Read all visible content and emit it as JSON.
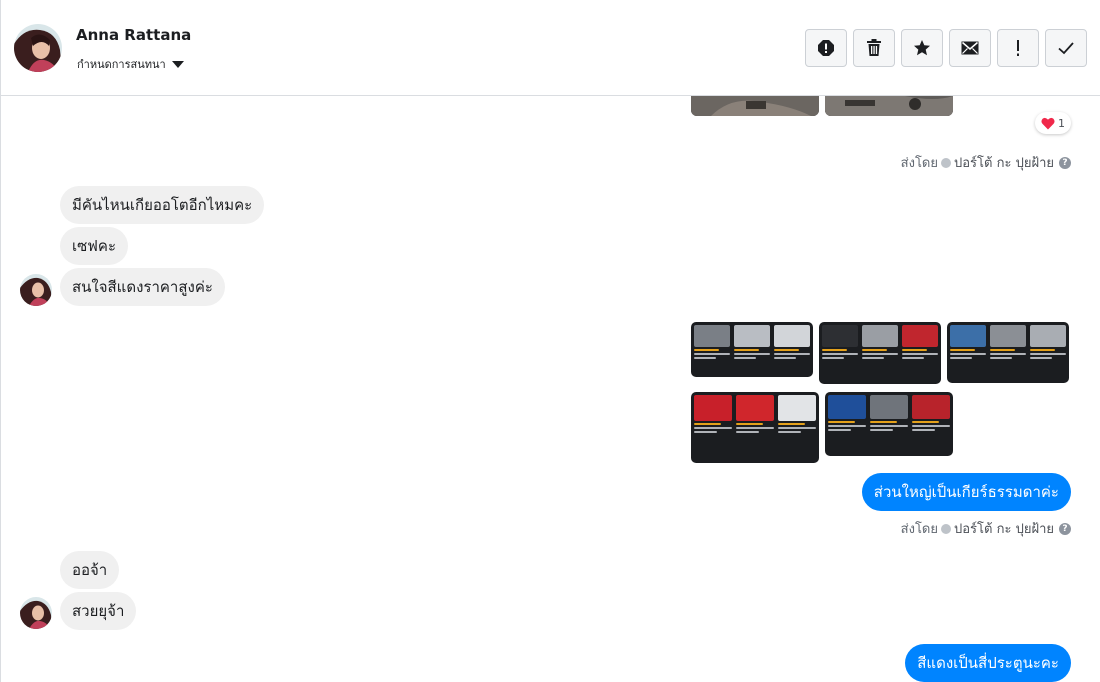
{
  "header": {
    "contact_name": "Anna Rattana",
    "status_label": "กำหนดการสนทนา",
    "toolbar": [
      {
        "name": "report-button",
        "icon": "alert-circle-icon"
      },
      {
        "name": "delete-button",
        "icon": "trash-icon"
      },
      {
        "name": "star-button",
        "icon": "star-icon"
      },
      {
        "name": "mark-unread-button",
        "icon": "envelope-icon"
      },
      {
        "name": "important-button",
        "icon": "exclamation-icon"
      },
      {
        "name": "mark-done-button",
        "icon": "check-icon"
      }
    ]
  },
  "thread": {
    "reaction": {
      "emoji": "❤️",
      "count": "1"
    },
    "sent_by": {
      "prefix": "ส่งโดย",
      "admin_name": "ปอร์โต้ กะ ปุยฝ้าย",
      "help": "?"
    },
    "incoming_group_1": [
      "มีคันไหนเกียออโตอีกไหมคะ",
      "เซฟคะ",
      "สนใจสีแดงราคาสูงค่ะ"
    ],
    "outgoing_1": "ส่วนใหญ่เป็นเกียร์ธรรมดาค่ะ",
    "incoming_group_2": [
      "ออจ้า",
      "สวยยุจ้า"
    ],
    "outgoing_2": "สีแดงเป็นสี่ประตูนะคะ"
  },
  "colors": {
    "accent": "#0084ff",
    "incoming_bubble": "#f0f0f0",
    "border": "#dadde1",
    "text": "#1c1e21"
  }
}
